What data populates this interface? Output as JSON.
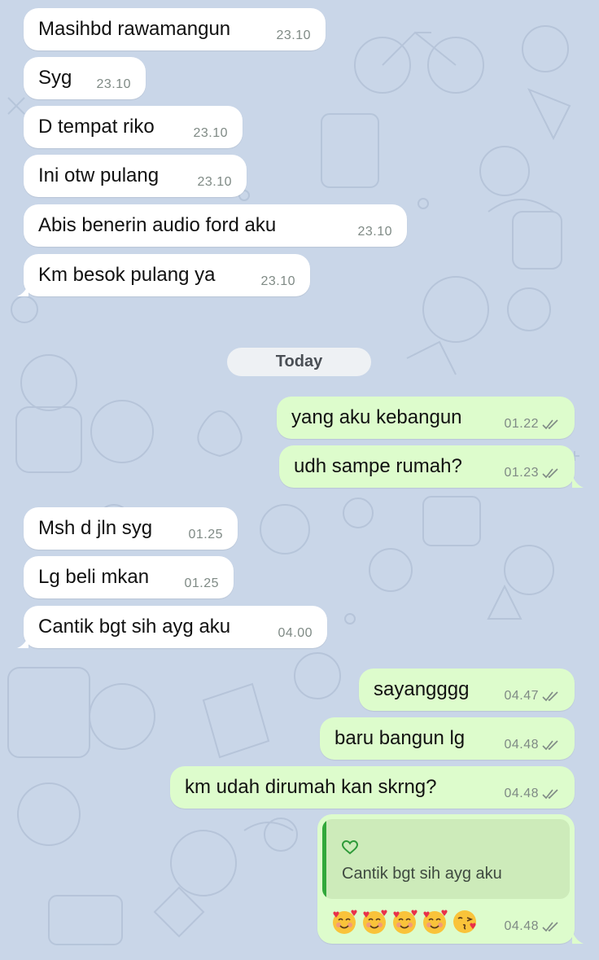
{
  "chat": {
    "date_divider": "Today",
    "messages": [
      {
        "text": "Masihbd rawamangun",
        "time": "23.10"
      },
      {
        "text": "Syg",
        "time": "23.10"
      },
      {
        "text": "D tempat riko",
        "time": "23.10"
      },
      {
        "text": "Ini otw pulang",
        "time": "23.10"
      },
      {
        "text": "Abis benerin audio ford aku",
        "time": "23.10"
      },
      {
        "text": "Km besok pulang ya",
        "time": "23.10"
      },
      {
        "text": "yang aku kebangun",
        "time": "01.22"
      },
      {
        "text": "udh sampe rumah?",
        "time": "01.23"
      },
      {
        "text": "Msh d jln syg",
        "time": "01.25"
      },
      {
        "text": "Lg beli mkan",
        "time": "01.25"
      },
      {
        "text": "Cantik bgt sih ayg aku",
        "time": "04.00"
      },
      {
        "text": "sayangggg",
        "time": "04.47"
      },
      {
        "text": "baru bangun lg",
        "time": "04.48"
      },
      {
        "text": "km udah dirumah kan skrng?",
        "time": "04.48"
      }
    ],
    "reply": {
      "quoted_icon": "heart-outline-icon",
      "quoted_text": "Cantik bgt sih ayg aku",
      "emojis": [
        "smiling-face-with-hearts",
        "smiling-face-with-hearts",
        "smiling-face-with-hearts",
        "smiling-face-with-hearts",
        "face-blowing-a-kiss"
      ],
      "time": "04.48"
    }
  },
  "colors": {
    "wallpaper": "#c9d6e8",
    "incoming_bubble": "#ffffff",
    "outgoing_bubble": "#ddfccc",
    "quote_background": "#cdebba",
    "quote_accent": "#31a83a",
    "timestamp": "#7f8a85"
  }
}
